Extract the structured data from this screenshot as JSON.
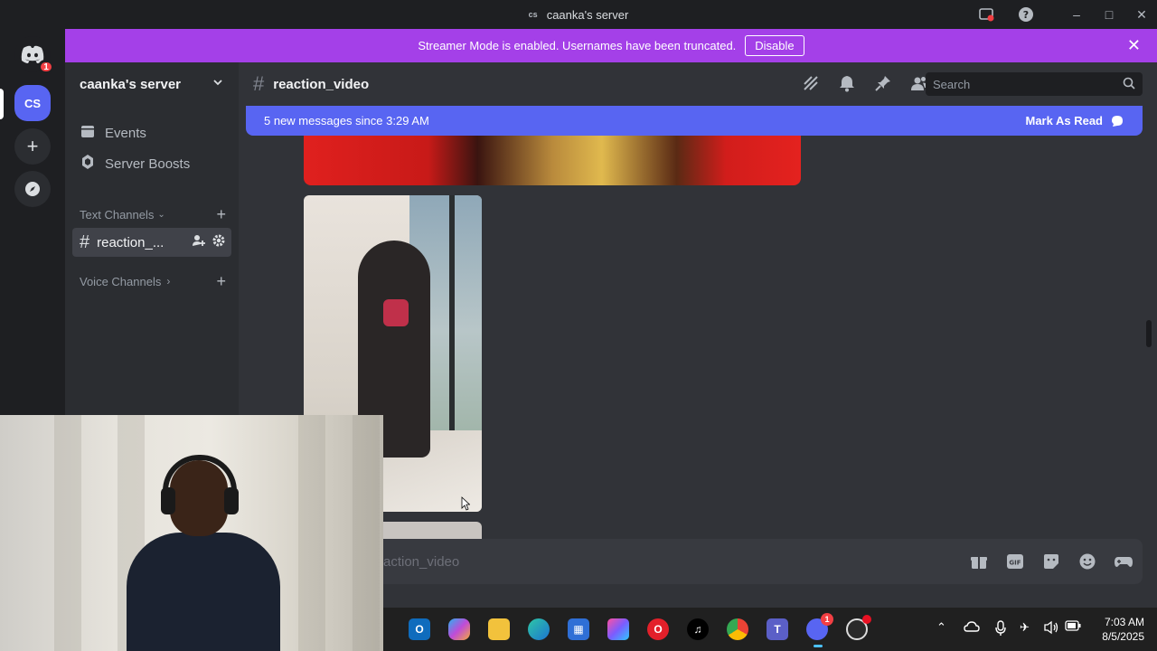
{
  "window": {
    "title": "caanka's server",
    "badge": "cs"
  },
  "banner": {
    "text": "Streamer Mode is enabled. Usernames have been truncated.",
    "button": "Disable"
  },
  "rail": {
    "home_ping": "1",
    "server_abbr": "CS"
  },
  "sidebar": {
    "server_name": "caanka's server",
    "items": [
      {
        "label": "Events",
        "icon": "calendar-icon"
      },
      {
        "label": "Server Boosts",
        "icon": "boost-icon"
      }
    ],
    "text_category": "Text Channels",
    "active_channel": "reaction_...",
    "voice_category": "Voice Channels"
  },
  "header": {
    "channel": "reaction_video",
    "search_placeholder": "Search"
  },
  "new_messages": {
    "text": "5 new messages since 3:29 AM",
    "action": "Mark As Read"
  },
  "composer": {
    "placeholder": "action_video"
  },
  "taskbar": {
    "time": "7:03 AM",
    "date": "8/5/2025",
    "discord_badge": "1"
  },
  "colors": {
    "brand": "#5865f2",
    "streamer_banner": "#a440e8",
    "background": "#313338",
    "sidebar": "#2b2d31"
  }
}
